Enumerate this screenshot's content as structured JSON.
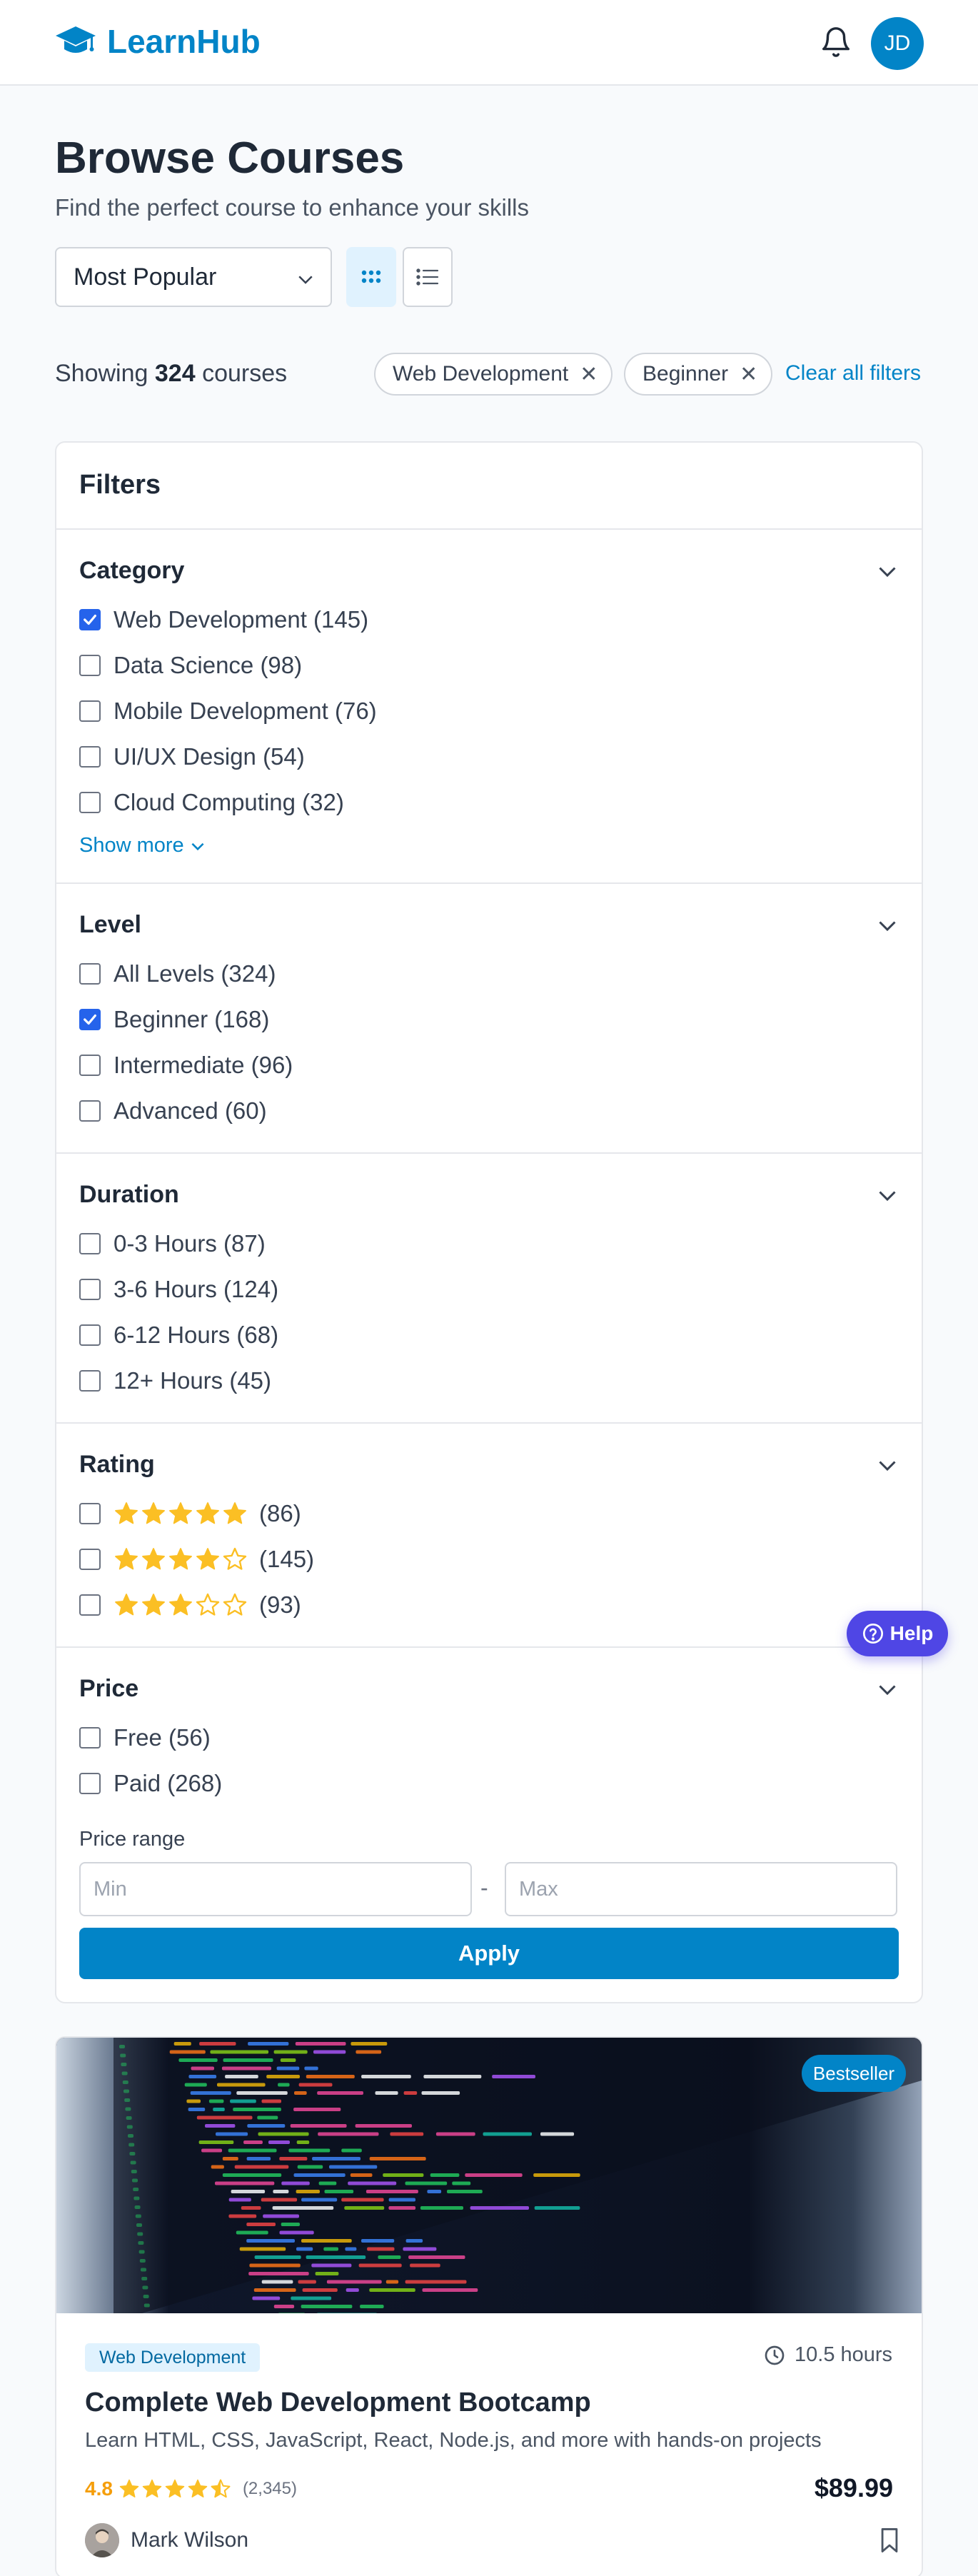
{
  "header": {
    "brand": "LearnHub",
    "avatar_initials": "JD"
  },
  "page": {
    "title": "Browse Courses",
    "subtitle": "Find the perfect course to enhance your skills",
    "sort_selected": "Most Popular"
  },
  "results": {
    "showing_prefix": "Showing",
    "count": "324",
    "suffix": "courses",
    "active_filters": [
      "Web Development",
      "Beginner"
    ],
    "clear_all": "Clear all filters"
  },
  "filters": {
    "title": "Filters",
    "category": {
      "title": "Category",
      "options": [
        {
          "label": "Web Development (145)",
          "checked": true
        },
        {
          "label": "Data Science (98)",
          "checked": false
        },
        {
          "label": "Mobile Development (76)",
          "checked": false
        },
        {
          "label": "UI/UX Design (54)",
          "checked": false
        },
        {
          "label": "Cloud Computing (32)",
          "checked": false
        }
      ],
      "show_more": "Show more"
    },
    "level": {
      "title": "Level",
      "options": [
        {
          "label": "All Levels (324)",
          "checked": false
        },
        {
          "label": "Beginner (168)",
          "checked": true
        },
        {
          "label": "Intermediate (96)",
          "checked": false
        },
        {
          "label": "Advanced (60)",
          "checked": false
        }
      ]
    },
    "duration": {
      "title": "Duration",
      "options": [
        {
          "label": "0-3 Hours (87)",
          "checked": false
        },
        {
          "label": "3-6 Hours (124)",
          "checked": false
        },
        {
          "label": "6-12 Hours (68)",
          "checked": false
        },
        {
          "label": "12+ Hours (45)",
          "checked": false
        }
      ]
    },
    "rating": {
      "title": "Rating",
      "options": [
        {
          "stars": 5,
          "count": "(86)",
          "checked": false
        },
        {
          "stars": 4,
          "count": "(145)",
          "checked": false
        },
        {
          "stars": 3,
          "count": "(93)",
          "checked": false
        }
      ]
    },
    "price": {
      "title": "Price",
      "options": [
        {
          "label": "Free (56)",
          "checked": false
        },
        {
          "label": "Paid (268)",
          "checked": false
        }
      ],
      "range_label": "Price range",
      "min_placeholder": "Min",
      "max_placeholder": "Max",
      "apply": "Apply"
    }
  },
  "help": {
    "label": "Help"
  },
  "course": {
    "badge": "Bestseller",
    "category": "Web Development",
    "duration": "10.5 hours",
    "title": "Complete Web Development Bootcamp",
    "description": "Learn HTML, CSS, JavaScript, React, Node.js, and more with hands-on projects",
    "rating": "4.8",
    "rating_stars": 4.5,
    "rating_count": "(2,345)",
    "price": "$89.99",
    "instructor": "Mark Wilson"
  },
  "colors": {
    "brand": "#0284c7",
    "star": "#fbbf24",
    "help": "#4f46e5",
    "checkbox_on": "#2563eb"
  }
}
